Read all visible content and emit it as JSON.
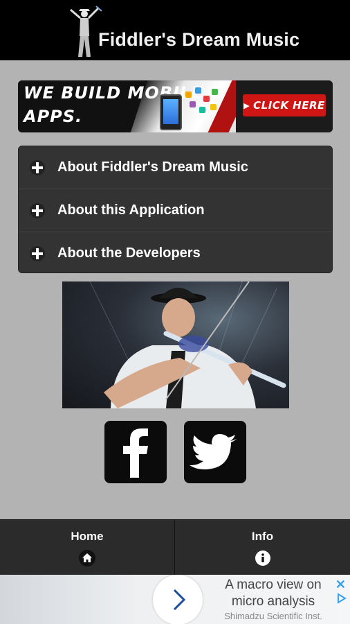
{
  "header": {
    "title": "Fiddler's Dream Music",
    "logo_icon": "dancer-silhouette-icon"
  },
  "banner": {
    "line1": "WE BUILD MOBILE",
    "line2": "APPS.",
    "cta": "CLICK HERE"
  },
  "accordion": {
    "items": [
      {
        "label": "About Fiddler's Dream Music",
        "icon": "plus-icon"
      },
      {
        "label": "About this Application",
        "icon": "plus-icon"
      },
      {
        "label": "About the Developers",
        "icon": "plus-icon"
      }
    ]
  },
  "photo": {
    "subject": "violinist-photo"
  },
  "social": {
    "facebook_icon": "facebook-icon",
    "twitter_icon": "twitter-icon"
  },
  "footer": {
    "tabs": [
      {
        "label": "Home",
        "icon": "home-icon"
      },
      {
        "label": "Info",
        "icon": "info-icon"
      }
    ]
  },
  "ad": {
    "line1": "A macro view on",
    "line2": "micro analysis",
    "line3": "Shimadzu Scientific Inst.",
    "close_icon": "close-icon",
    "adchoices_icon": "adchoices-icon",
    "arrow_icon": "chevron-right-icon"
  },
  "colors": {
    "header_bg": "#000000",
    "page_bg": "#b3b3b3",
    "accordion_bg": "#333333",
    "cta_red": "#d01515",
    "ad_accent": "#3aa0e8"
  }
}
